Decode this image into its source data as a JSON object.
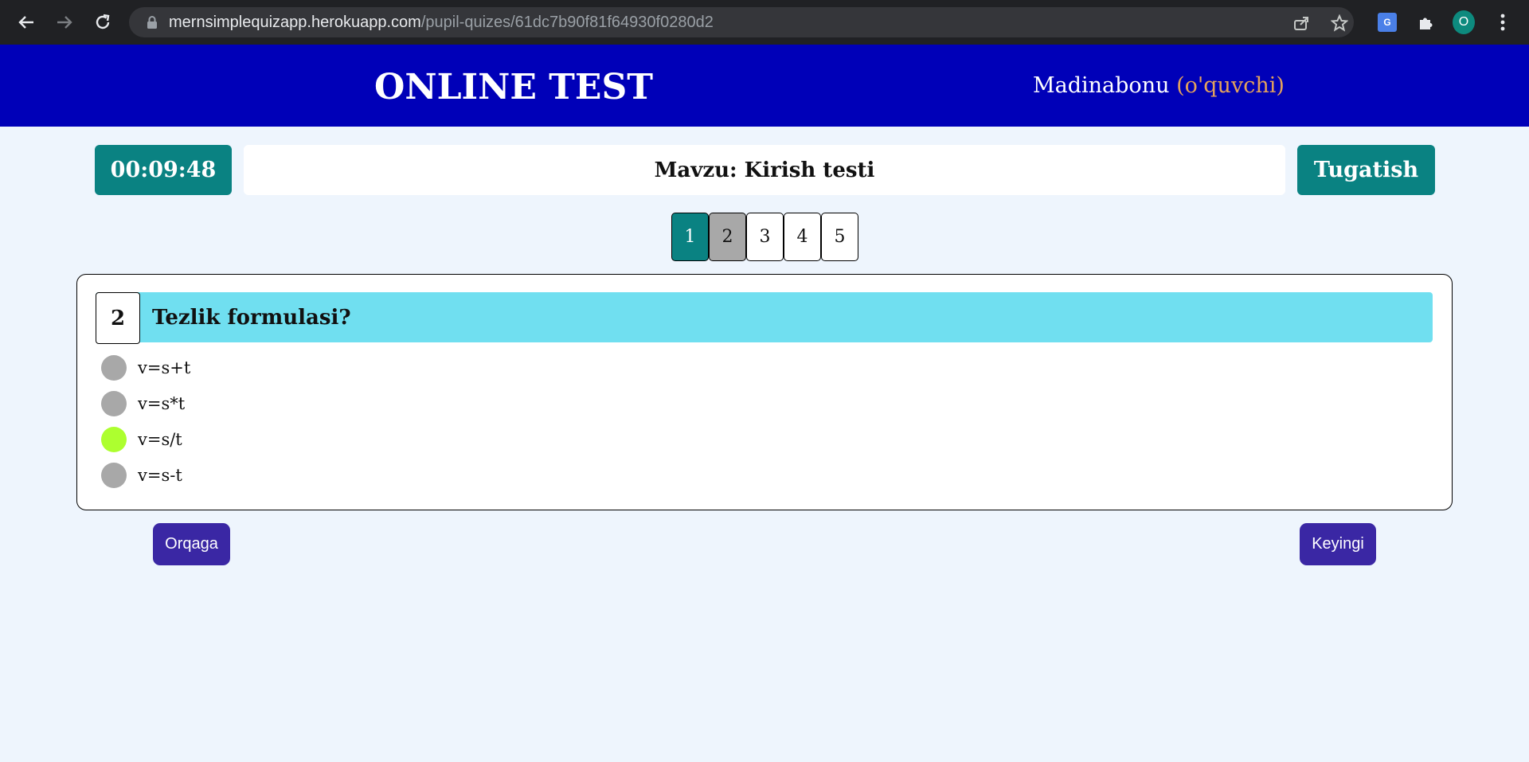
{
  "browser": {
    "url_host": "mernsimplequizapp.herokuapp.com",
    "url_path": "/pupil-quizes/61dc7b90f81f64930f0280d2",
    "translate_label": "G",
    "profile_initial": "O"
  },
  "header": {
    "title": "ONLINE TEST",
    "user_name": "Madinabonu",
    "user_role": "(o'quvchi)"
  },
  "quiz": {
    "timer": "00:09:48",
    "topic": "Mavzu: Kirish testi",
    "finish_label": "Tugatish",
    "pages": [
      "1",
      "2",
      "3",
      "4",
      "5"
    ],
    "active_page": "1",
    "question_number": "2",
    "question_text": "Tezlik formulasi?",
    "options": [
      "v=s+t",
      "v=s*t",
      "v=s/t",
      "v=s-t"
    ],
    "selected_option": "v=s/t",
    "back_label": "Orqaga",
    "next_label": "Keyingi"
  },
  "colors": {
    "header_bg": "#0000b8",
    "teal": "#0a8282",
    "question_bar": "#70dff0",
    "selected_radio": "#adff2f",
    "nav_button": "#3a27a4"
  }
}
